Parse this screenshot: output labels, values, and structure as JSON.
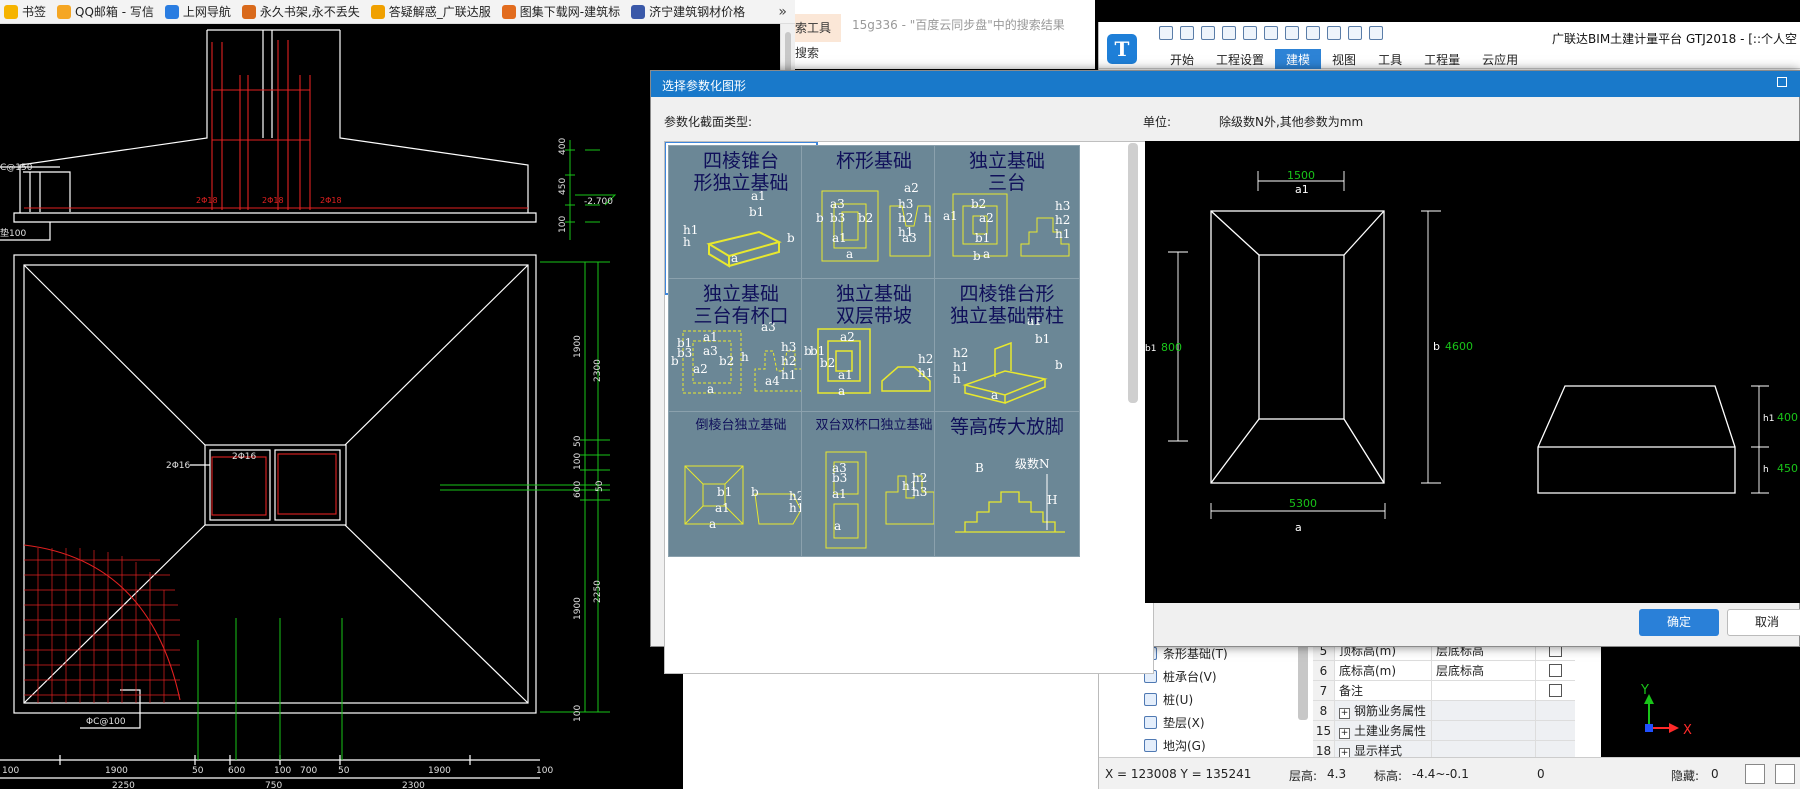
{
  "bookmarks": [
    {
      "label": "书签",
      "icon": "bookmark-icon",
      "color": "#f6b400"
    },
    {
      "label": "QQ邮箱 - 写信",
      "icon": "qqmail-icon",
      "color": "#f5a623"
    },
    {
      "label": "上网导航",
      "icon": "nav-icon",
      "color": "#2a7de1"
    },
    {
      "label": "永久书架,永不丢失",
      "icon": "bookshelf-icon",
      "color": "#d96a1c"
    },
    {
      "label": "答疑解惑_广联达服",
      "icon": "qa-icon",
      "color": "#f0a000"
    },
    {
      "label": "图集下载网-建筑标",
      "icon": "atlas-icon",
      "color": "#e26c1e"
    },
    {
      "label": "济宁建筑钢材价格",
      "icon": "price-icon",
      "color": "#3a58a8"
    }
  ],
  "bookmarks_more": "»",
  "browser": {
    "tool_tab": "索工具",
    "search_tab": "搜索",
    "breadcrumb": "15g336 - \"百度云同步盘\"中的搜索结果"
  },
  "cad": {
    "dims_bottom": [
      "100",
      "1900",
      "50",
      "600",
      "100",
      "700",
      "50",
      "1900",
      "100"
    ],
    "dims_total": [
      "2250",
      "750",
      "2300"
    ],
    "dims_right_upper": [
      "400",
      "450",
      "100"
    ],
    "dims_right_lower": [
      "1900",
      "2300",
      "50",
      "100",
      "600",
      "2250",
      "1900",
      "100"
    ],
    "right_mid_label": "50",
    "level_mark": "-2.700",
    "left_label_1": "C@150",
    "left_label_2": "垫100",
    "inner_label": "2Φ16",
    "inner_label_2": "2Φ16",
    "bottom_label": "ΦC@100",
    "rebar_text": [
      "2Φ18",
      "2Φ18",
      "2Φ18"
    ]
  },
  "app": {
    "logo": "T",
    "title": "广联达BIM土建计量平台 GTJ2018 - [::个人空",
    "ribbon_tabs": [
      "开始",
      "工程设置",
      "建模",
      "视图",
      "工具",
      "工程量",
      "云应用"
    ],
    "active_tab": "建模",
    "tree_items": [
      {
        "label": "条形基础(T)",
        "icon": "strip-foundation-icon"
      },
      {
        "label": "桩承台(V)",
        "icon": "pile-cap-icon"
      },
      {
        "label": "桩(U)",
        "icon": "pile-icon"
      },
      {
        "label": "垫层(X)",
        "icon": "cushion-icon"
      },
      {
        "label": "地沟(G)",
        "icon": "trench-icon"
      }
    ],
    "props": [
      {
        "num": "5",
        "key": "顶标高(m)",
        "value": "层底标高",
        "check": true
      },
      {
        "num": "6",
        "key": "底标高(m)",
        "value": "层底标高",
        "check": true
      },
      {
        "num": "7",
        "key": "备注",
        "value": "",
        "check": true
      },
      {
        "num": "8",
        "key": "钢筋业务属性",
        "value": "",
        "group": true
      },
      {
        "num": "15",
        "key": "土建业务属性",
        "value": "",
        "group": true
      },
      {
        "num": "18",
        "key": "显示样式",
        "value": "",
        "group": true
      }
    ],
    "status": {
      "coords": "X = 123008 Y = 135241",
      "floor_label": "层高:",
      "floor_value": "4.3",
      "elev_label": "标高:",
      "elev_value": "-4.4~-0.1",
      "count": "0",
      "hidden_label": "隐藏:",
      "hidden_value": "0"
    },
    "axis": {
      "y": "Y",
      "x": "X"
    },
    "side": {
      "up": "0",
      "down": "0"
    }
  },
  "dialog": {
    "title": "选择参数化图形",
    "type_label": "参数化截面类型:",
    "unit_label": "单位:",
    "unit_desc": "除级数N外,其他参数为mm",
    "ok": "确定",
    "cancel": "取消",
    "tiles": [
      {
        "name": "四棱锥台\n形独立基础",
        "labels": [
          "a1",
          "b1",
          "a",
          "b",
          "h1",
          "h"
        ],
        "selected": true
      },
      {
        "name": "杯形基础",
        "labels": [
          "a2",
          "a3",
          "b2",
          "b3",
          "b",
          "a1",
          "a",
          "h3",
          "h2",
          "h1",
          "h",
          "a3"
        ]
      },
      {
        "name": "独立基础\n三台",
        "labels": [
          "b2",
          "a2",
          "a1",
          "b1",
          "a",
          "b",
          "h3",
          "h2",
          "h1"
        ]
      },
      {
        "name": "独立基础\n三台有杯口",
        "labels": [
          "a1",
          "a3",
          "b1",
          "b3",
          "b2",
          "a2",
          "a",
          "b",
          "a3",
          "h3",
          "h2",
          "h1",
          "h",
          "a4"
        ]
      },
      {
        "name": "独立基础\n双层带坡",
        "labels": [
          "a2",
          "b1",
          "b2",
          "a1",
          "a",
          "b",
          "h2",
          "h1"
        ]
      },
      {
        "name": "四棱锥台形\n独立基础带柱",
        "labels": [
          "a1",
          "b1",
          "b",
          "h2",
          "h1",
          "h",
          "a"
        ]
      },
      {
        "name": "倒棱台独立基础",
        "labels": [
          "b1",
          "a1",
          "a",
          "b",
          "h2",
          "h1"
        ],
        "small": true
      },
      {
        "name": "双台双杯口独立基础",
        "labels": [
          "a3",
          "b3",
          "a1",
          "h1",
          "h2",
          "h3",
          "a"
        ],
        "small": true
      },
      {
        "name": "等高砖大放脚",
        "labels": [
          "B",
          "级数N",
          "H"
        ]
      }
    ],
    "preview": {
      "a1_value": "1500",
      "a1_label": "a1",
      "b1_label": "b1",
      "b1_value": "800",
      "b_label": "b",
      "b_value": "4600",
      "a_value": "5300",
      "a_label": "a",
      "h1_label": "h1",
      "h1_value": "400",
      "h_label": "h",
      "h_value": "450"
    }
  }
}
